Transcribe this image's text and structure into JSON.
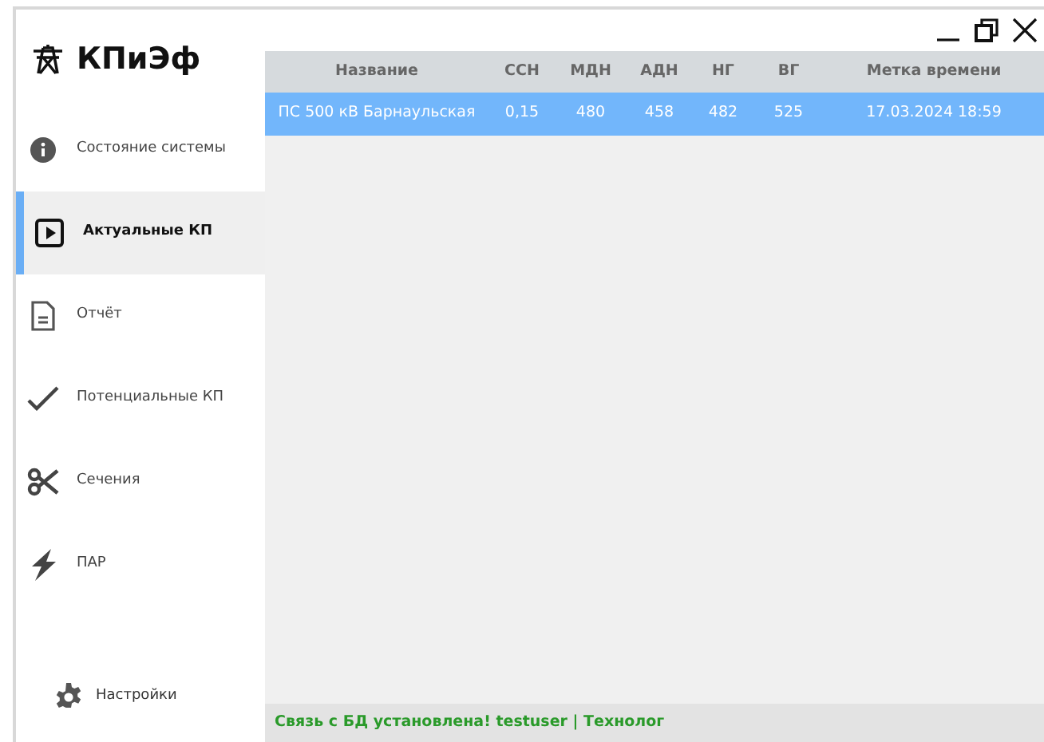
{
  "app": {
    "title": "КПиЭф"
  },
  "window_controls": [
    {
      "kind": "minimize"
    },
    {
      "kind": "restore"
    },
    {
      "kind": "close"
    }
  ],
  "sidebar": {
    "items": [
      {
        "label": "Состояние системы",
        "kind": "info",
        "selected": false
      },
      {
        "label": "Актуальные КП",
        "kind": "play",
        "selected": true
      },
      {
        "label": "Отчёт",
        "kind": "doc",
        "selected": false
      },
      {
        "label": "Потенциальные КП",
        "kind": "check",
        "selected": false
      },
      {
        "label": "Сечения",
        "kind": "scissors",
        "selected": false
      },
      {
        "label": "ПАР",
        "kind": "bolt",
        "selected": false
      }
    ],
    "settings": {
      "label": "Настройки"
    }
  },
  "table": {
    "columns": [
      "Название",
      "ССН",
      "МДН",
      "АДН",
      "НГ",
      "ВГ",
      "Метка времени"
    ],
    "rows": [
      {
        "cells": [
          "ПС 500 кВ Барнаульская",
          "0,15",
          "480",
          "458",
          "482",
          "525",
          "17.03.2024 18:59"
        ],
        "selected": true
      }
    ]
  },
  "status_bar": {
    "text": "Связь с БД установлена! testuser | Технолог"
  }
}
